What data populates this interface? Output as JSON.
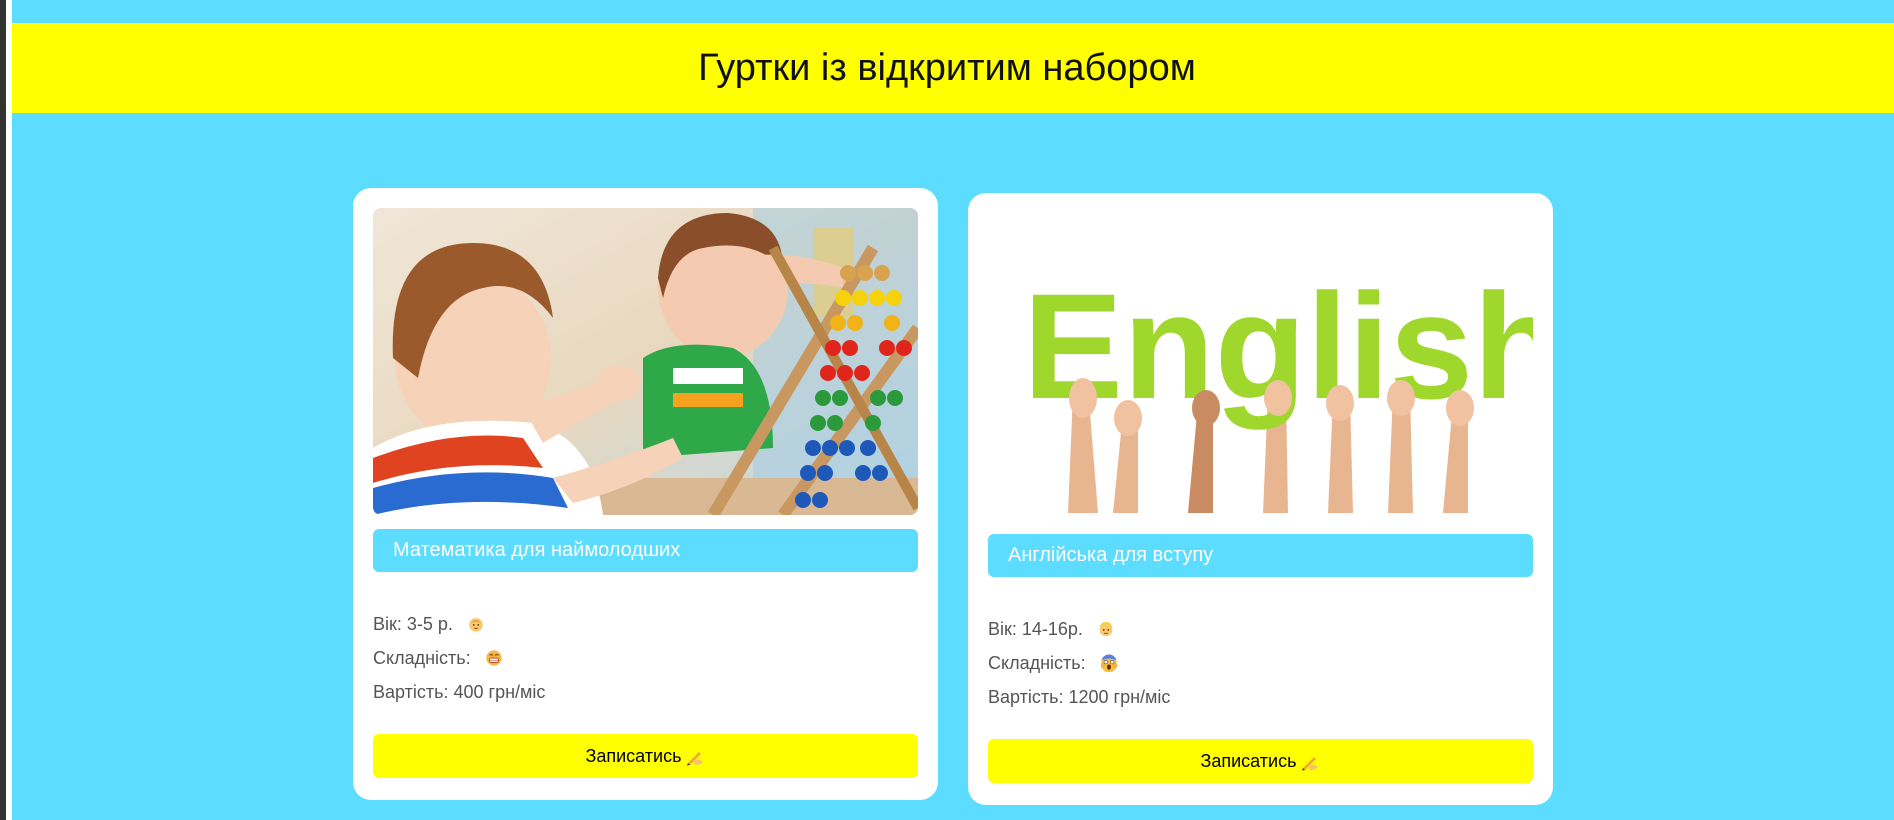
{
  "header": {
    "title": "Гуртки із відкритим набором"
  },
  "cards": [
    {
      "image_icon": "kids-abacus-photo",
      "title": "Математика для наймолодших",
      "age": "Вік: 3-5 р.",
      "age_icon": "baby-emoji-icon",
      "difficulty": "Складність:",
      "difficulty_icon": "grinning-emoji-icon",
      "price": "Вартість: 400 грн/міс",
      "button": "Записатись"
    },
    {
      "image_icon": "english-letters-photo",
      "image_text": "English",
      "title": "Англійська для вступу",
      "age": "Вік: 14-16р.",
      "age_icon": "blond-person-emoji-icon",
      "difficulty": "Складність:",
      "difficulty_icon": "screaming-emoji-icon",
      "price": "Вартість: 1200 грн/міс",
      "button": "Записатись"
    }
  ],
  "colors": {
    "background": "#5cdcff",
    "header": "#ffff00",
    "button": "#ffff00",
    "card": "#ffffff"
  }
}
